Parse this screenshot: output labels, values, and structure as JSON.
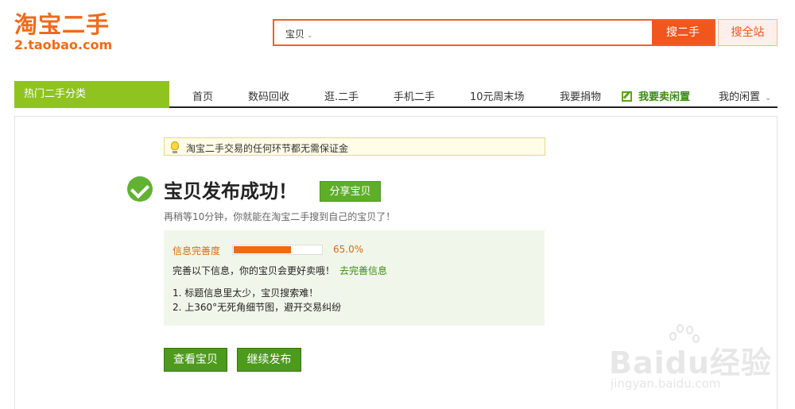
{
  "header": {
    "logo_cn": "淘宝二手",
    "logo_url": "2.taobao.com",
    "search_category": "宝贝",
    "search_value": "",
    "search_button": "搜二手",
    "search_all_button": "搜全站"
  },
  "nav": {
    "category_label": "热门二手分类",
    "items": [
      {
        "label": "首页"
      },
      {
        "label": "数码回收"
      },
      {
        "label": "逛.二手"
      },
      {
        "label": "手机二手"
      },
      {
        "label": "10元周末场"
      },
      {
        "label": "我要捐物"
      }
    ],
    "sell_label": "我要卖闲置",
    "mine_label": "我的闲置"
  },
  "notice": "淘宝二手交易的任何环节都无需保证金",
  "result": {
    "title": "宝贝发布成功！",
    "share_button": "分享宝贝",
    "subtext": "再稍等10分钟，你就能在淘宝二手搜到自己的宝贝了！"
  },
  "completeness": {
    "label": "信息完善度",
    "value_text": "65.0%",
    "fraction": 0.65,
    "improve_text": "完善以下信息，你的宝贝会更好卖哦！",
    "improve_link": "去完善信息",
    "tips": [
      "1. 标题信息里太少，宝贝搜索难！",
      "2. 上360°无死角细节图，避开交易纠纷"
    ]
  },
  "actions": {
    "view_button": "查看宝贝",
    "continue_button": "继续发布"
  },
  "watermark": {
    "text": "Baidu经验",
    "url": "jingyan.baidu.com"
  },
  "colors": {
    "brand_orange": "#f2561c",
    "green": "#5fae2a",
    "nav_green": "#8fc31f"
  }
}
